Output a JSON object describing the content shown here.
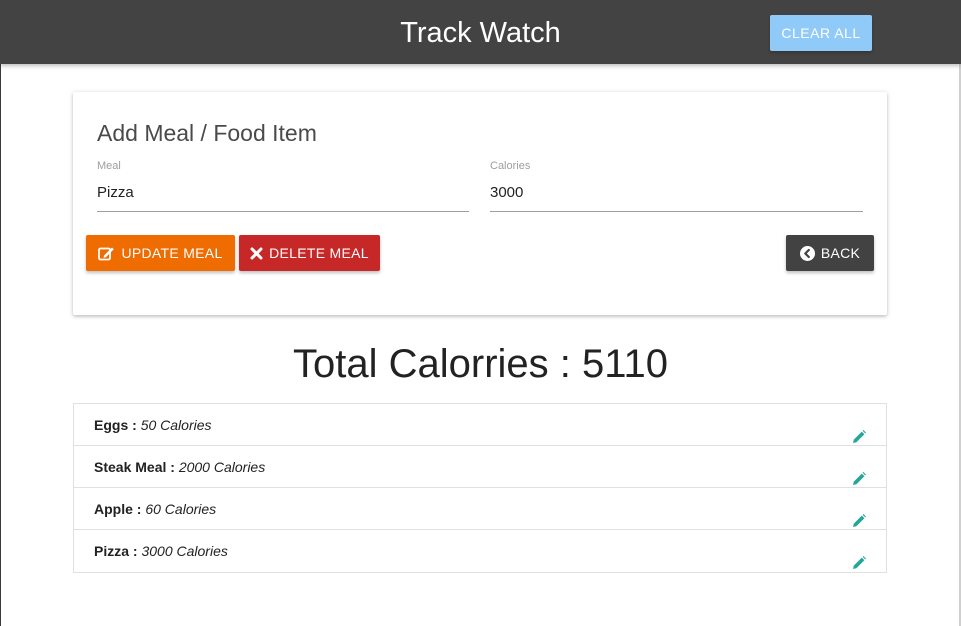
{
  "navbar": {
    "brand": "Track Watch",
    "clear_all_label": "CLEAR ALL"
  },
  "form": {
    "title": "Add Meal / Food Item",
    "meal_label": "Meal",
    "meal_value": "Pizza",
    "calories_label": "Calories",
    "calories_value": "3000",
    "update_label": "UPDATE MEAL",
    "delete_label": "DELETE MEAL",
    "back_label": "BACK"
  },
  "total": {
    "label": "Total Calorries : ",
    "value": "5110"
  },
  "items": [
    {
      "name": "Eggs",
      "separator": " : ",
      "calories": "50 Calories"
    },
    {
      "name": "Steak Meal",
      "separator": " : ",
      "calories": "2000 Calories"
    },
    {
      "name": "Apple",
      "separator": " : ",
      "calories": "60 Calories"
    },
    {
      "name": "Pizza",
      "separator": " : ",
      "calories": "3000 Calories"
    }
  ],
  "colors": {
    "navbar": "#434343",
    "clear_all": "#90caf9",
    "update": "#ef6c00",
    "delete": "#c62828",
    "back": "#424242",
    "edit_icon": "#26a69a"
  },
  "icons": {
    "update": "pencil-square-icon",
    "delete": "close-icon",
    "back": "chevron-circle-left-icon",
    "edit": "pencil-icon"
  }
}
